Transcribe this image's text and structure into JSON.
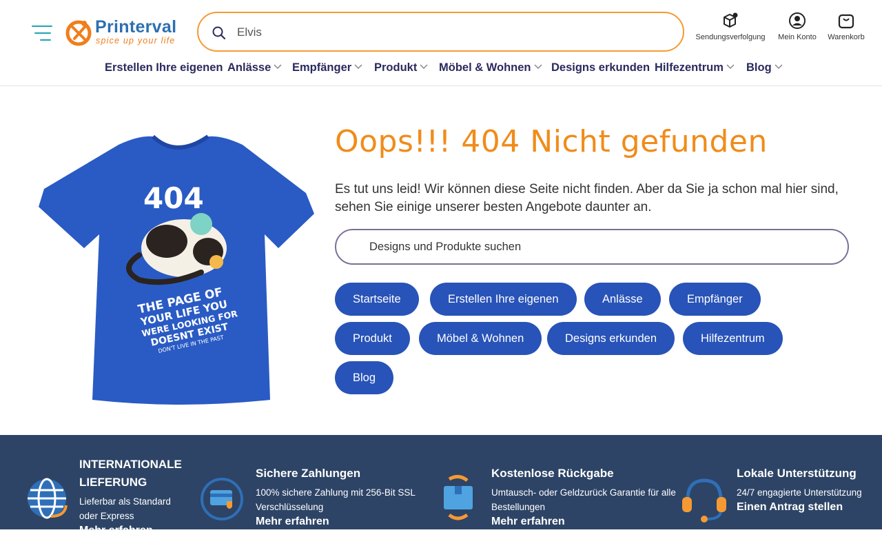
{
  "header": {
    "logo_name": "Printerval",
    "logo_tagline": "spice up your life",
    "search_value": "Elvis",
    "actions": {
      "tracking": "Sendungsverfolgung",
      "account": "Mein Konto",
      "cart": "Warenkorb"
    }
  },
  "nav": {
    "items": [
      {
        "label": "Erstellen Ihre eigenen",
        "dropdown": false
      },
      {
        "label": "Anlässe",
        "dropdown": true
      },
      {
        "label": "Empfänger",
        "dropdown": true
      },
      {
        "label": "Produkt",
        "dropdown": true
      },
      {
        "label": "Möbel & Wohnen",
        "dropdown": true
      },
      {
        "label": "Designs erkunden",
        "dropdown": false
      },
      {
        "label": "Hilfezentrum",
        "dropdown": true
      },
      {
        "label": "Blog",
        "dropdown": true
      }
    ]
  },
  "main": {
    "title": "Oops!!! 404 Nicht gefunden",
    "description": "Es tut uns leid! Wir können diese Seite nicht finden. Aber da Sie ja schon mal hier sind, sehen Sie einige unserer besten Angebote daunter an.",
    "search_placeholder": "Designs und Produkte suchen",
    "pills": [
      "Startseite",
      "Erstellen Ihre eigenen",
      "Anlässe",
      "Empfänger",
      "Produkt",
      "Möbel & Wohnen",
      "Designs erkunden",
      "Hilfezentrum",
      "Blog"
    ],
    "shirt": {
      "big": "404",
      "line1": "THE PAGE OF",
      "line2": "YOUR LIFE YOU",
      "line3": "WERE LOOKING FOR",
      "line4": "DOESNT EXIST",
      "line5": "DON'T LIVE IN THE PAST"
    }
  },
  "footer": {
    "cols": [
      {
        "title": "INTERNATIONALE LIEFERUNG",
        "text": "Lieferbar als Standard oder Express",
        "link": "Mehr erfahren",
        "icon": "globe-delivery-icon"
      },
      {
        "title": "Sichere Zahlungen",
        "text": "100% sichere Zahlung mit 256-Bit SSL Verschlüsselung",
        "link": "Mehr erfahren",
        "icon": "secure-card-icon"
      },
      {
        "title": "Kostenlose Rückgabe",
        "text": "Umtausch- oder Geldzurück Garantie für alle Bestellungen",
        "link": "Mehr erfahren",
        "icon": "return-box-icon"
      },
      {
        "title": "Lokale Unterstützung",
        "text": "24/7 engagierte Unterstützung",
        "link": "Einen Antrag stellen",
        "icon": "headset-icon"
      }
    ]
  },
  "colors": {
    "accent_orange": "#f08c1a",
    "pill_blue": "#2853b8",
    "footer_bg": "#2d4466",
    "nav_text": "#2a2a5e"
  }
}
